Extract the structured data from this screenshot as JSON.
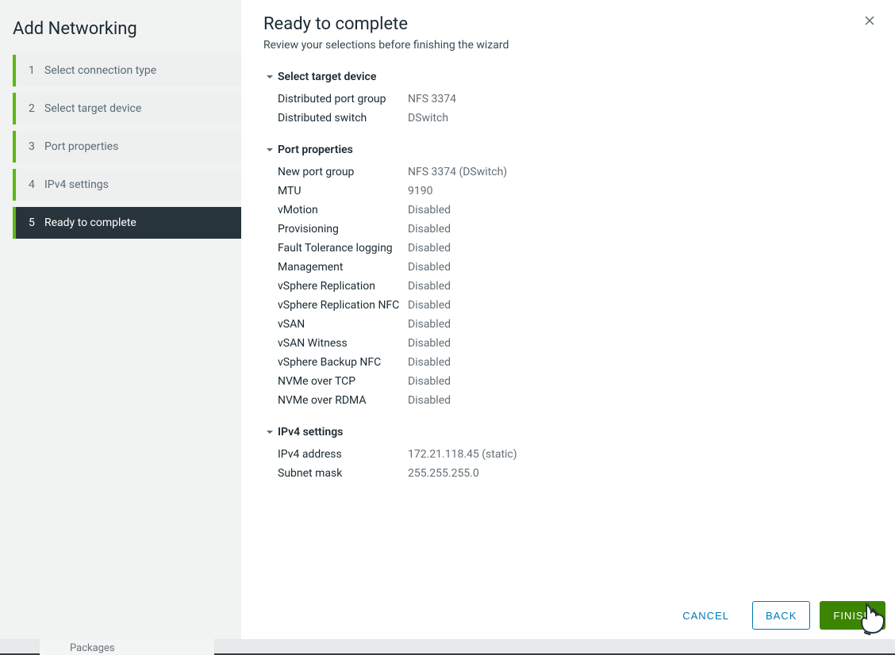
{
  "wizard": {
    "title": "Add Networking",
    "steps": [
      {
        "num": "1",
        "label": "Select connection type"
      },
      {
        "num": "2",
        "label": "Select target device"
      },
      {
        "num": "3",
        "label": "Port properties"
      },
      {
        "num": "4",
        "label": "IPv4 settings"
      },
      {
        "num": "5",
        "label": "Ready to complete"
      }
    ]
  },
  "page": {
    "title": "Ready to complete",
    "subtitle": "Review your selections before finishing the wizard"
  },
  "sections": {
    "target": {
      "title": "Select target device",
      "rows": [
        {
          "k": "Distributed port group",
          "v": "NFS 3374"
        },
        {
          "k": "Distributed switch",
          "v": "DSwitch"
        }
      ]
    },
    "port": {
      "title": "Port properties",
      "rows": [
        {
          "k": "New port group",
          "v": "NFS 3374 (DSwitch)"
        },
        {
          "k": "MTU",
          "v": "9190"
        },
        {
          "k": "vMotion",
          "v": "Disabled"
        },
        {
          "k": "Provisioning",
          "v": "Disabled"
        },
        {
          "k": "Fault Tolerance logging",
          "v": "Disabled"
        },
        {
          "k": "Management",
          "v": "Disabled"
        },
        {
          "k": "vSphere Replication",
          "v": "Disabled"
        },
        {
          "k": "vSphere Replication NFC",
          "v": "Disabled"
        },
        {
          "k": "vSAN",
          "v": "Disabled"
        },
        {
          "k": "vSAN Witness",
          "v": "Disabled"
        },
        {
          "k": "vSphere Backup NFC",
          "v": "Disabled"
        },
        {
          "k": "NVMe over TCP",
          "v": "Disabled"
        },
        {
          "k": "NVMe over RDMA",
          "v": "Disabled"
        }
      ]
    },
    "ipv4": {
      "title": "IPv4 settings",
      "rows": [
        {
          "k": "IPv4 address",
          "v": "172.21.118.45 (static)"
        },
        {
          "k": "Subnet mask",
          "v": "255.255.255.0"
        }
      ]
    }
  },
  "footer": {
    "cancel": "CANCEL",
    "back": "BACK",
    "finish": "FINISH"
  },
  "background": {
    "packages": "Packages"
  }
}
